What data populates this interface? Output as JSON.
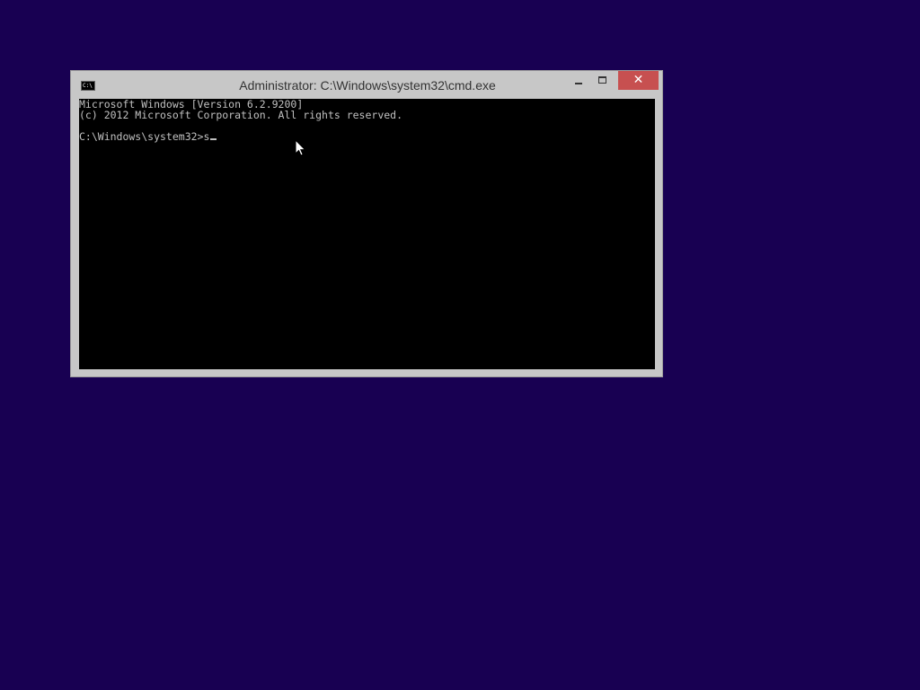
{
  "desktop": {
    "background_color": "#180052"
  },
  "window": {
    "title": "Administrator: C:\\Windows\\system32\\cmd.exe",
    "icon": "cmd-icon",
    "icon_text": "C:\\",
    "controls": {
      "minimize_icon": "minimize-icon",
      "maximize_icon": "maximize-icon",
      "close_icon": "close-icon",
      "close_glyph": "✕",
      "close_color": "#c75050"
    }
  },
  "console": {
    "lines": [
      "Microsoft Windows [Version 6.2.9200]",
      "(c) 2012 Microsoft Corporation. All rights reserved.",
      "",
      "C:\\Windows\\system32>"
    ],
    "typed_input": "s",
    "text_color": "#c0c0c0",
    "background_color": "#000000"
  },
  "pointer": {
    "icon": "arrow-pointer-icon"
  }
}
